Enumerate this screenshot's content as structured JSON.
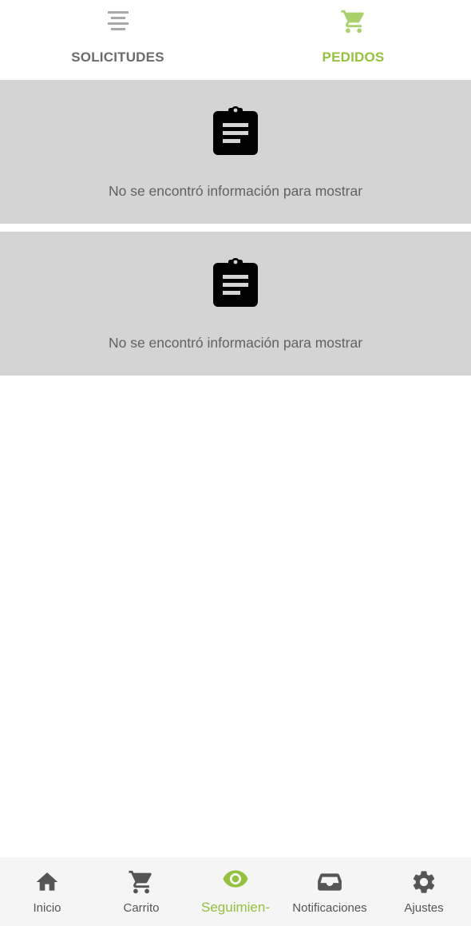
{
  "top_tabs": [
    {
      "label": "SOLICITUDES",
      "icon": "list-icon",
      "active": false
    },
    {
      "label": "PEDIDOS",
      "icon": "cart-icon",
      "active": true
    }
  ],
  "cards": [
    {
      "icon": "clipboard-icon",
      "message": "No se encontró información para mostrar"
    },
    {
      "icon": "clipboard-icon",
      "message": "No se encontró información para mostrar"
    }
  ],
  "bottom_nav": [
    {
      "label": "Inicio",
      "icon": "home-icon",
      "active": false
    },
    {
      "label": "Carrito",
      "icon": "cart-icon",
      "active": false
    },
    {
      "label": "Seguimien-",
      "icon": "eye-icon",
      "active": true
    },
    {
      "label": "Notificaciones",
      "icon": "inbox-icon",
      "active": false
    },
    {
      "label": "Ajustes",
      "icon": "gear-icon",
      "active": false
    }
  ],
  "colors": {
    "accent": "#94c23c",
    "inactive_tab": "#6b6b6b",
    "card_background": "#d4d4d4",
    "nav_background": "#f5f5f5",
    "nav_icon": "#555555"
  }
}
